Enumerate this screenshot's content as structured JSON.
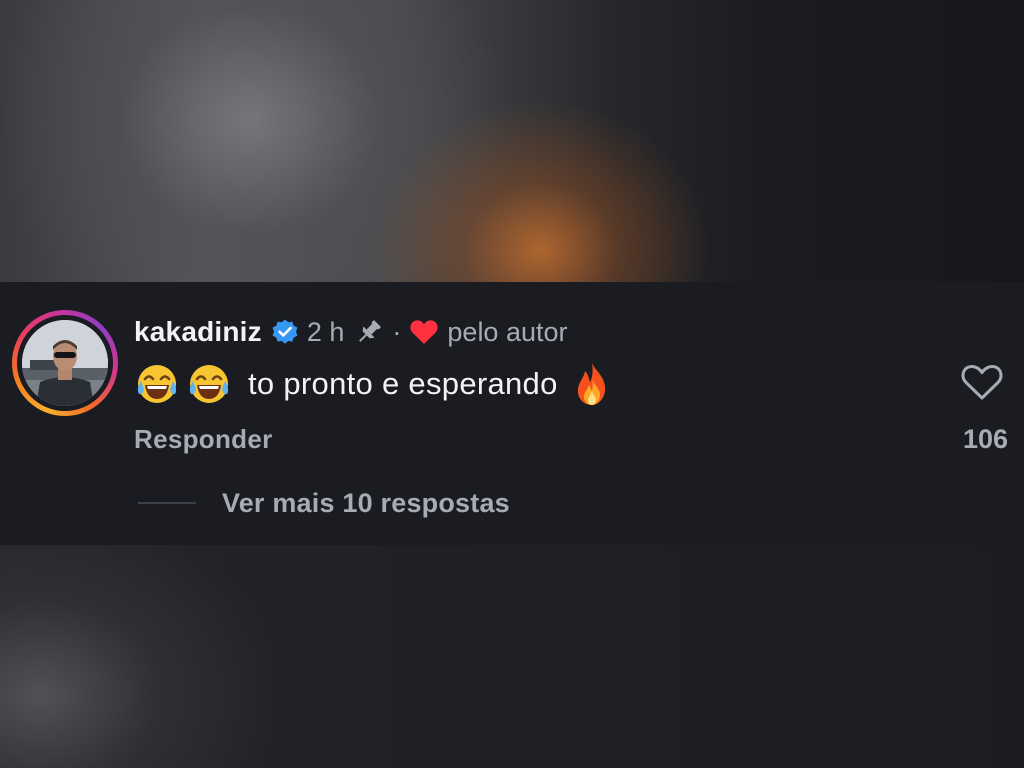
{
  "comment": {
    "username": "kakadiniz",
    "verified_icon": "verified-badge-icon",
    "time": "2 h",
    "pin_icon": "pin-icon",
    "separator": "·",
    "author_like_icon": "heart-filled-icon",
    "author_like_color": "#ff3040",
    "by_author_text": "pelo autor",
    "emojis": [
      "😂",
      "😂"
    ],
    "text": "to pronto e esperando",
    "trailing_emoji": "🔥",
    "like_icon": "heart-outline-icon",
    "like_count": "106",
    "reply_label": "Responder",
    "more_replies_label": "Ver mais 10 respostas"
  },
  "colors": {
    "background": "#1a1c21",
    "primary_text": "#f2f3f5",
    "secondary_text": "#a7abb2",
    "verified_blue": "#3897f0"
  }
}
